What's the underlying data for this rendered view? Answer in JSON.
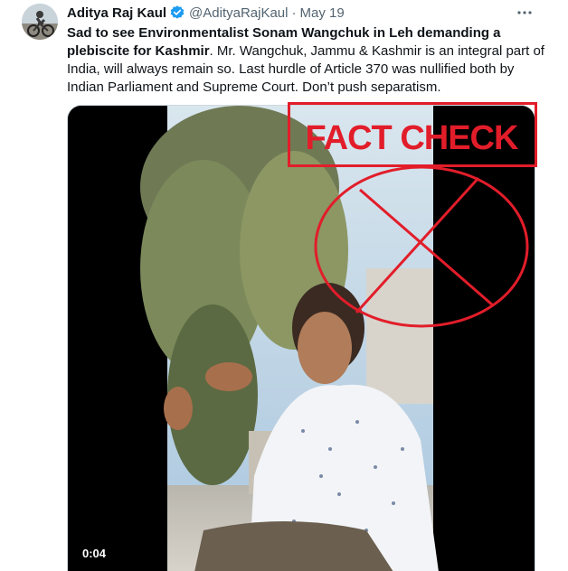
{
  "author": {
    "display_name": "Aditya Raj Kaul",
    "handle": "@AdityaRajKaul",
    "separator": "·",
    "date": "May 19",
    "verified_color": "#1d9bf0"
  },
  "tweet": {
    "bold_text": "Sad to see Environmentalist Sonam Wangchuk in Leh demanding a plebiscite for Kashmir",
    "rest_text": ". Mr. Wangchuk, Jammu & Kashmir is an integral part of India, will always remain so. Last hurdle of Article 370 was nullified both by Indian Parliament and Supreme Court. Don’t  push separatism."
  },
  "media": {
    "duration": "0:04",
    "overlay_text": "FACT CHECK",
    "overlay_color": "#e21d2a"
  },
  "icons": {
    "more": "more-icon",
    "verified": "verified-badge-icon"
  }
}
